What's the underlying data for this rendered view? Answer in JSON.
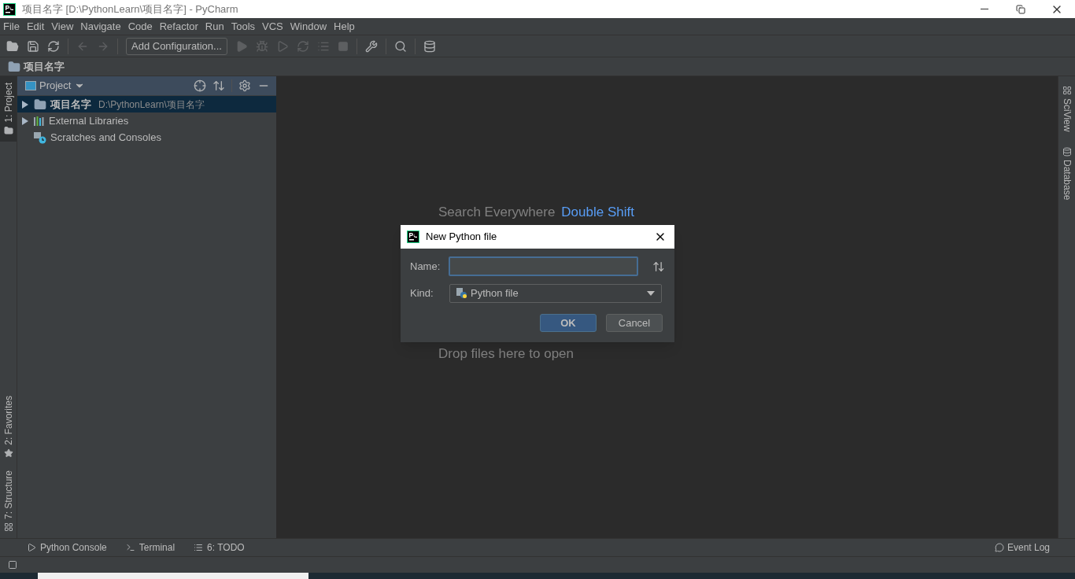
{
  "window": {
    "title": "项目名字 [D:\\PythonLearn\\项目名字] - PyCharm"
  },
  "menu": [
    "File",
    "Edit",
    "View",
    "Navigate",
    "Code",
    "Refactor",
    "Run",
    "Tools",
    "VCS",
    "Window",
    "Help"
  ],
  "toolbar": {
    "run_config": "Add Configuration..."
  },
  "breadcrumb": "项目名字",
  "left_stripe": [
    {
      "label": "1: Project",
      "selected": true
    },
    {
      "label": "2: Favorites",
      "selected": false
    },
    {
      "label": "7: Structure",
      "selected": false
    }
  ],
  "project_panel": {
    "title": "Project",
    "tree": [
      {
        "name": "项目名字",
        "path": "D:\\PythonLearn\\项目名字",
        "expanded": false,
        "selected": true,
        "kind": "folder"
      },
      {
        "name": "External Libraries",
        "expanded": false,
        "selected": false,
        "kind": "libraries"
      },
      {
        "name": "Scratches and Consoles",
        "selected": false,
        "kind": "scratches"
      }
    ]
  },
  "editor_hints": [
    {
      "action": "Search Everywhere",
      "shortcut": "Double Shift"
    },
    {
      "action": "Drop files here to open"
    }
  ],
  "right_stripe": [
    "SciView",
    "Database"
  ],
  "dialog": {
    "title": "New Python file",
    "name_label": "Name:",
    "kind_label": "Kind:",
    "kind_value": "Python file",
    "buttons": [
      {
        "label": "OK",
        "default": true
      },
      {
        "label": "Cancel",
        "default": false
      }
    ]
  },
  "bottom_tabs": [
    "Python Console",
    "Terminal",
    "6: TODO"
  ],
  "event_log": "Event Log"
}
